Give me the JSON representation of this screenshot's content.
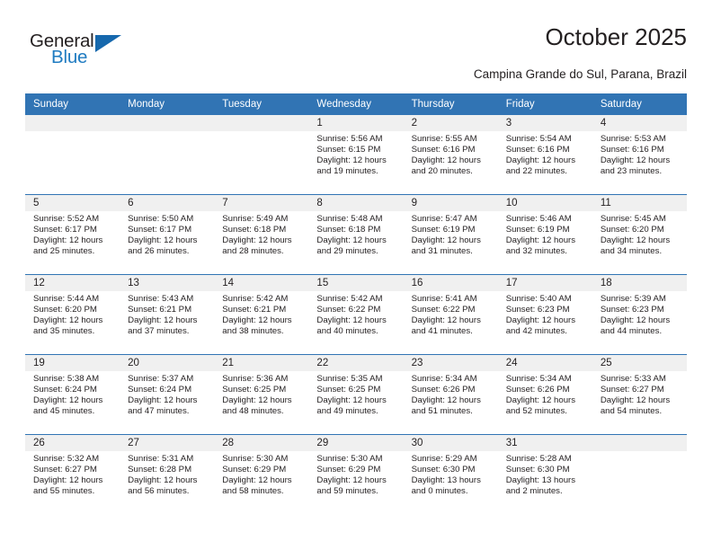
{
  "brand": {
    "name_part1": "General",
    "name_part2": "Blue",
    "triangle_icon": "triangle-icon",
    "color_dark": "#231f20",
    "color_blue": "#1f7bc1"
  },
  "header": {
    "title": "October 2025",
    "subtitle": "Campina Grande do Sul, Parana, Brazil"
  },
  "theme": {
    "header_bg": "#3174b4",
    "daynum_bg": "#f0f0f0",
    "text": "#231f20"
  },
  "weekday_headers": [
    "Sunday",
    "Monday",
    "Tuesday",
    "Wednesday",
    "Thursday",
    "Friday",
    "Saturday"
  ],
  "weeks": [
    [
      {
        "day": "",
        "sunrise": "",
        "sunset": "",
        "daylight1": "",
        "daylight2": "",
        "blank": true
      },
      {
        "day": "",
        "sunrise": "",
        "sunset": "",
        "daylight1": "",
        "daylight2": "",
        "blank": true
      },
      {
        "day": "",
        "sunrise": "",
        "sunset": "",
        "daylight1": "",
        "daylight2": "",
        "blank": true
      },
      {
        "day": "1",
        "sunrise": "Sunrise: 5:56 AM",
        "sunset": "Sunset: 6:15 PM",
        "daylight1": "Daylight: 12 hours",
        "daylight2": "and 19 minutes."
      },
      {
        "day": "2",
        "sunrise": "Sunrise: 5:55 AM",
        "sunset": "Sunset: 6:16 PM",
        "daylight1": "Daylight: 12 hours",
        "daylight2": "and 20 minutes."
      },
      {
        "day": "3",
        "sunrise": "Sunrise: 5:54 AM",
        "sunset": "Sunset: 6:16 PM",
        "daylight1": "Daylight: 12 hours",
        "daylight2": "and 22 minutes."
      },
      {
        "day": "4",
        "sunrise": "Sunrise: 5:53 AM",
        "sunset": "Sunset: 6:16 PM",
        "daylight1": "Daylight: 12 hours",
        "daylight2": "and 23 minutes."
      }
    ],
    [
      {
        "day": "5",
        "sunrise": "Sunrise: 5:52 AM",
        "sunset": "Sunset: 6:17 PM",
        "daylight1": "Daylight: 12 hours",
        "daylight2": "and 25 minutes."
      },
      {
        "day": "6",
        "sunrise": "Sunrise: 5:50 AM",
        "sunset": "Sunset: 6:17 PM",
        "daylight1": "Daylight: 12 hours",
        "daylight2": "and 26 minutes."
      },
      {
        "day": "7",
        "sunrise": "Sunrise: 5:49 AM",
        "sunset": "Sunset: 6:18 PM",
        "daylight1": "Daylight: 12 hours",
        "daylight2": "and 28 minutes."
      },
      {
        "day": "8",
        "sunrise": "Sunrise: 5:48 AM",
        "sunset": "Sunset: 6:18 PM",
        "daylight1": "Daylight: 12 hours",
        "daylight2": "and 29 minutes."
      },
      {
        "day": "9",
        "sunrise": "Sunrise: 5:47 AM",
        "sunset": "Sunset: 6:19 PM",
        "daylight1": "Daylight: 12 hours",
        "daylight2": "and 31 minutes."
      },
      {
        "day": "10",
        "sunrise": "Sunrise: 5:46 AM",
        "sunset": "Sunset: 6:19 PM",
        "daylight1": "Daylight: 12 hours",
        "daylight2": "and 32 minutes."
      },
      {
        "day": "11",
        "sunrise": "Sunrise: 5:45 AM",
        "sunset": "Sunset: 6:20 PM",
        "daylight1": "Daylight: 12 hours",
        "daylight2": "and 34 minutes."
      }
    ],
    [
      {
        "day": "12",
        "sunrise": "Sunrise: 5:44 AM",
        "sunset": "Sunset: 6:20 PM",
        "daylight1": "Daylight: 12 hours",
        "daylight2": "and 35 minutes."
      },
      {
        "day": "13",
        "sunrise": "Sunrise: 5:43 AM",
        "sunset": "Sunset: 6:21 PM",
        "daylight1": "Daylight: 12 hours",
        "daylight2": "and 37 minutes."
      },
      {
        "day": "14",
        "sunrise": "Sunrise: 5:42 AM",
        "sunset": "Sunset: 6:21 PM",
        "daylight1": "Daylight: 12 hours",
        "daylight2": "and 38 minutes."
      },
      {
        "day": "15",
        "sunrise": "Sunrise: 5:42 AM",
        "sunset": "Sunset: 6:22 PM",
        "daylight1": "Daylight: 12 hours",
        "daylight2": "and 40 minutes."
      },
      {
        "day": "16",
        "sunrise": "Sunrise: 5:41 AM",
        "sunset": "Sunset: 6:22 PM",
        "daylight1": "Daylight: 12 hours",
        "daylight2": "and 41 minutes."
      },
      {
        "day": "17",
        "sunrise": "Sunrise: 5:40 AM",
        "sunset": "Sunset: 6:23 PM",
        "daylight1": "Daylight: 12 hours",
        "daylight2": "and 42 minutes."
      },
      {
        "day": "18",
        "sunrise": "Sunrise: 5:39 AM",
        "sunset": "Sunset: 6:23 PM",
        "daylight1": "Daylight: 12 hours",
        "daylight2": "and 44 minutes."
      }
    ],
    [
      {
        "day": "19",
        "sunrise": "Sunrise: 5:38 AM",
        "sunset": "Sunset: 6:24 PM",
        "daylight1": "Daylight: 12 hours",
        "daylight2": "and 45 minutes."
      },
      {
        "day": "20",
        "sunrise": "Sunrise: 5:37 AM",
        "sunset": "Sunset: 6:24 PM",
        "daylight1": "Daylight: 12 hours",
        "daylight2": "and 47 minutes."
      },
      {
        "day": "21",
        "sunrise": "Sunrise: 5:36 AM",
        "sunset": "Sunset: 6:25 PM",
        "daylight1": "Daylight: 12 hours",
        "daylight2": "and 48 minutes."
      },
      {
        "day": "22",
        "sunrise": "Sunrise: 5:35 AM",
        "sunset": "Sunset: 6:25 PM",
        "daylight1": "Daylight: 12 hours",
        "daylight2": "and 49 minutes."
      },
      {
        "day": "23",
        "sunrise": "Sunrise: 5:34 AM",
        "sunset": "Sunset: 6:26 PM",
        "daylight1": "Daylight: 12 hours",
        "daylight2": "and 51 minutes."
      },
      {
        "day": "24",
        "sunrise": "Sunrise: 5:34 AM",
        "sunset": "Sunset: 6:26 PM",
        "daylight1": "Daylight: 12 hours",
        "daylight2": "and 52 minutes."
      },
      {
        "day": "25",
        "sunrise": "Sunrise: 5:33 AM",
        "sunset": "Sunset: 6:27 PM",
        "daylight1": "Daylight: 12 hours",
        "daylight2": "and 54 minutes."
      }
    ],
    [
      {
        "day": "26",
        "sunrise": "Sunrise: 5:32 AM",
        "sunset": "Sunset: 6:27 PM",
        "daylight1": "Daylight: 12 hours",
        "daylight2": "and 55 minutes."
      },
      {
        "day": "27",
        "sunrise": "Sunrise: 5:31 AM",
        "sunset": "Sunset: 6:28 PM",
        "daylight1": "Daylight: 12 hours",
        "daylight2": "and 56 minutes."
      },
      {
        "day": "28",
        "sunrise": "Sunrise: 5:30 AM",
        "sunset": "Sunset: 6:29 PM",
        "daylight1": "Daylight: 12 hours",
        "daylight2": "and 58 minutes."
      },
      {
        "day": "29",
        "sunrise": "Sunrise: 5:30 AM",
        "sunset": "Sunset: 6:29 PM",
        "daylight1": "Daylight: 12 hours",
        "daylight2": "and 59 minutes."
      },
      {
        "day": "30",
        "sunrise": "Sunrise: 5:29 AM",
        "sunset": "Sunset: 6:30 PM",
        "daylight1": "Daylight: 13 hours",
        "daylight2": "and 0 minutes."
      },
      {
        "day": "31",
        "sunrise": "Sunrise: 5:28 AM",
        "sunset": "Sunset: 6:30 PM",
        "daylight1": "Daylight: 13 hours",
        "daylight2": "and 2 minutes."
      },
      {
        "day": "",
        "sunrise": "",
        "sunset": "",
        "daylight1": "",
        "daylight2": "",
        "blank": true
      }
    ]
  ]
}
